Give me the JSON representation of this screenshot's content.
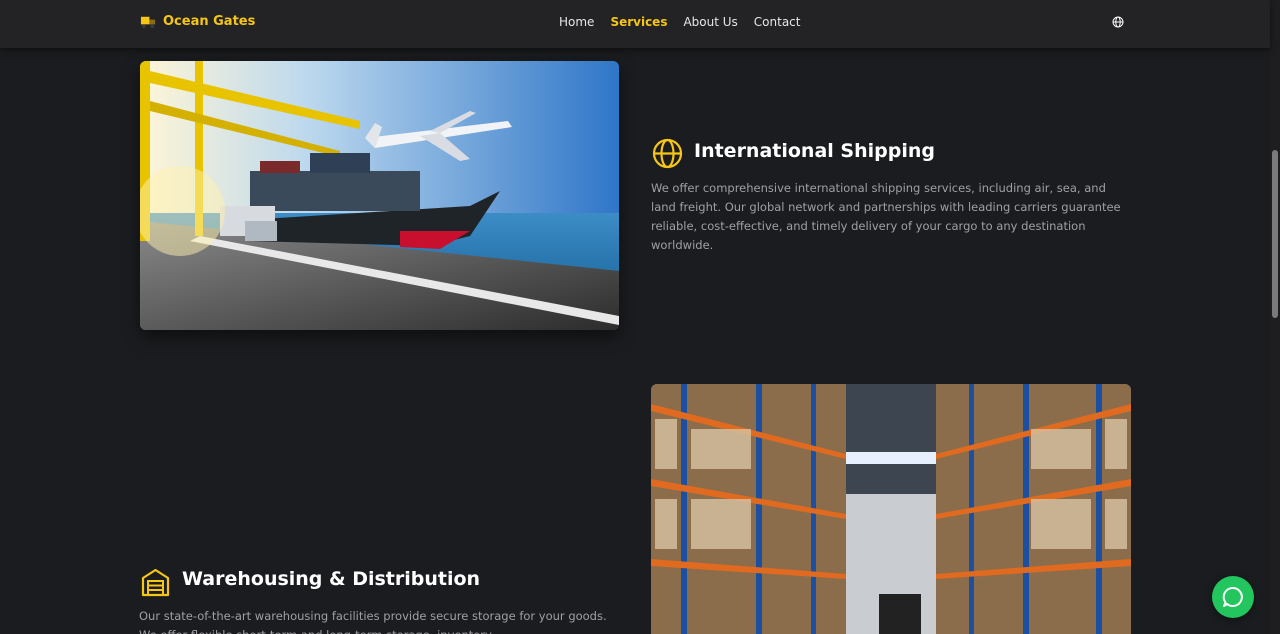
{
  "brand": {
    "name": "Ocean Gates",
    "logo_icon": "warehouse-truck-icon"
  },
  "nav": {
    "items": [
      {
        "label": "Home",
        "active": false
      },
      {
        "label": "Services",
        "active": true
      },
      {
        "label": "About Us",
        "active": false
      },
      {
        "label": "Contact",
        "active": false
      }
    ],
    "language_icon": "globe-icon"
  },
  "services": [
    {
      "title": "International Shipping",
      "icon": "globe-icon",
      "description": "We offer comprehensive international shipping services, including air, sea, and land freight. Our global network and partnerships with leading carriers guarantee reliable, cost-effective, and timely delivery of your cargo to any destination worldwide.",
      "image": "cargo-ship-plane-truck-photo"
    },
    {
      "title": "Warehousing & Distribution",
      "icon": "warehouse-icon",
      "description": "Our state-of-the-art warehousing facilities provide secure storage for your goods. We offer flexible short-term and long-term storage, inventory",
      "image": "warehouse-shelves-photo"
    }
  ],
  "chat": {
    "icon": "chat-bubble-icon"
  },
  "colors": {
    "accent": "#f5c518",
    "background": "#1b1c1f",
    "navbar": "#232325",
    "chat": "#23c55e"
  }
}
